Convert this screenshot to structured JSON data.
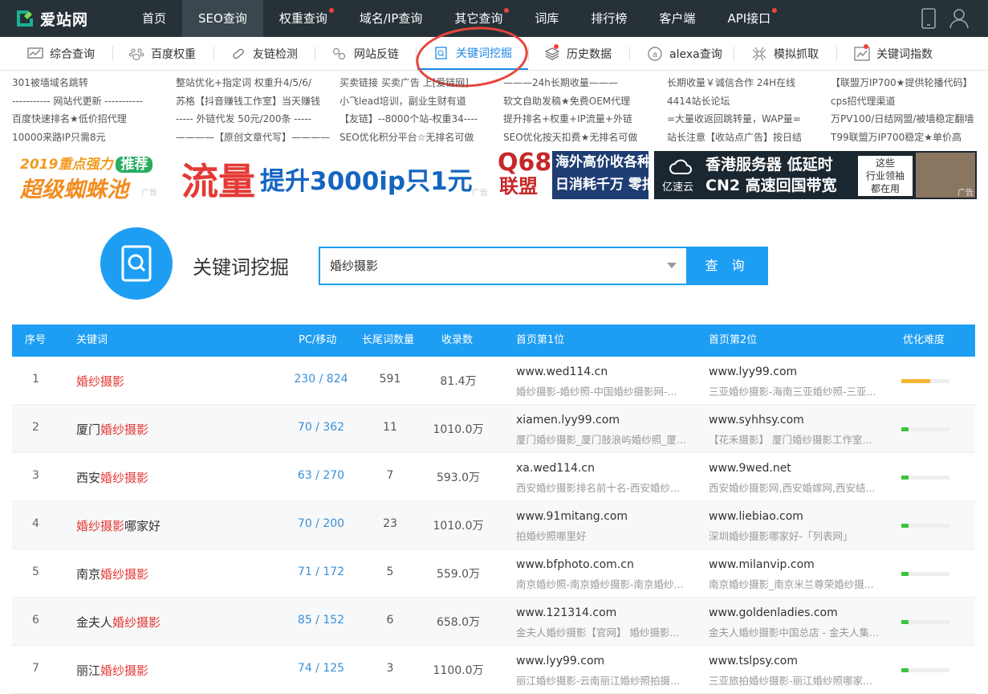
{
  "brand": {
    "name": "爱站网",
    "color": "#19b394"
  },
  "nav": {
    "items": [
      {
        "label": "首页",
        "dot": false
      },
      {
        "label": "SEO查询",
        "dot": false,
        "active": true
      },
      {
        "label": "权重查询",
        "dot": true
      },
      {
        "label": "域名/IP查询",
        "dot": false
      },
      {
        "label": "其它查询",
        "dot": true
      },
      {
        "label": "词库",
        "dot": false
      },
      {
        "label": "排行榜",
        "dot": false
      },
      {
        "label": "客户端",
        "dot": false
      },
      {
        "label": "API接口",
        "dot": true
      }
    ]
  },
  "subnav": {
    "items": [
      {
        "label": "综合查询",
        "icon": "chart-monitor-icon"
      },
      {
        "label": "百度权重",
        "icon": "baidu-paw-icon"
      },
      {
        "label": "友链检测",
        "icon": "link-icon"
      },
      {
        "label": "网站反链",
        "icon": "backlink-icon"
      },
      {
        "label": "关键词挖掘",
        "icon": "dig-icon",
        "active": true
      },
      {
        "label": "历史数据",
        "icon": "layers-icon",
        "dot": true
      },
      {
        "label": "alexa查询",
        "icon": "alexa-icon"
      },
      {
        "label": "模拟抓取",
        "icon": "spider-icon"
      },
      {
        "label": "关键词指数",
        "icon": "trend-icon",
        "dot": true
      }
    ]
  },
  "ads": {
    "text": [
      [
        "301被墙域名跳转",
        "----------- 网站代更新 -----------",
        "百度快速排名★低价招代理",
        "10000来路IP只需8元"
      ],
      [
        "整站优化+指定词 权重升4/5/6/",
        "苏格【抖音赚钱工作室】当天赚钱",
        "----- 外链代发 50元/200条 -----",
        "————【原创文章代写】————"
      ],
      [
        "买卖链接 买卖广告 上[爱链网]",
        "小飞lead培训，副业生财有道",
        "【友链】--8000个站-权重34----",
        "SEO优化积分平台☆无排名可做"
      ],
      [
        "———24h长期收量———",
        "软文自助发稿★免费OEM代理",
        "提升排名+权重+IP流量+外链",
        "SEO优化按天扣费★无排名可做"
      ],
      [
        "长期收量￥诚信合作 24H在线",
        "4414站长论坛",
        "=大量收返回跳转量，WAP量=",
        "站长注意【收站点广告】按日结"
      ],
      [
        "【联盟万IP700★提供轮播代码】",
        "cps招代理渠道",
        "万PV100/日结网盟/被墙稳定翻墙",
        "T99联盟万IP700稳定★单价高"
      ]
    ],
    "banners": [
      {
        "line1": "2019重点强力",
        "badge": "推荐",
        "line2": "超级蜘蛛池",
        "tag": "广告"
      },
      {
        "big": "流量",
        "rest": "提升3000ip只1元",
        "tag": "广告"
      },
      {
        "brand1": "Q68",
        "brand2": "联盟",
        "t1": "海外高价收各种量",
        "t2": "日消耗千万 零扣量"
      },
      {
        "logo": "亿速云",
        "t1": "香港服务器 低延时",
        "t2": "CN2 高速回国带宽",
        "side1": "这些",
        "side2": "行业领袖",
        "side3": "都在用",
        "tag": "广告"
      }
    ]
  },
  "search": {
    "title": "关键词挖掘",
    "value": "婚纱摄影",
    "button": "查 询"
  },
  "table": {
    "headers": {
      "no": "序号",
      "kw": "关键词",
      "pc": "PC/移动",
      "tail": "长尾词数量",
      "idx": "收录数",
      "first": "首页第1位",
      "second": "首页第2位",
      "diff": "优化难度"
    },
    "rows": [
      {
        "no": "1",
        "pre": "",
        "hl": "婚纱摄影",
        "post": "",
        "pc": "230 / 824",
        "tail": "591",
        "idx": "81.4万",
        "d1": "www.wed114.cn",
        "t1": "婚纱摄影-婚纱照-中国婚纱摄影网-...",
        "d2": "www.lyy99.com",
        "t2": "三亚婚纱摄影-海南三亚婚纱照-三亚...",
        "diff": 0.6,
        "color": "#f5b731"
      },
      {
        "no": "2",
        "pre": "厦门",
        "hl": "婚纱摄影",
        "post": "",
        "pc": "70 / 362",
        "tail": "11",
        "idx": "1010.0万",
        "d1": "xiamen.lyy99.com",
        "t1": "厦门婚纱摄影_厦门鼓浪屿婚纱照_厦...",
        "d2": "www.syhhsy.com",
        "t2": "【花禾摄影】 厦门婚纱摄影工作室...",
        "diff": 0.15,
        "color": "#3cc43c"
      },
      {
        "no": "3",
        "pre": "西安",
        "hl": "婚纱摄影",
        "post": "",
        "pc": "63 / 270",
        "tail": "7",
        "idx": "593.0万",
        "d1": "xa.wed114.cn",
        "t1": "西安婚纱摄影排名前十名-西安婚纱...",
        "d2": "www.9wed.net",
        "t2": "西安婚纱摄影网,西安婚嫁网,西安结...",
        "diff": 0.15,
        "color": "#3cc43c"
      },
      {
        "no": "4",
        "pre": "",
        "hl": "婚纱摄影",
        "post": "哪家好",
        "pc": "70 / 200",
        "tail": "23",
        "idx": "1010.0万",
        "d1": "www.91mitang.com",
        "t1": "拍婚纱照哪里好",
        "d2": "www.liebiao.com",
        "t2": "深圳婚纱摄影哪家好-「列表网」",
        "diff": 0.15,
        "color": "#3cc43c"
      },
      {
        "no": "5",
        "pre": "南京",
        "hl": "婚纱摄影",
        "post": "",
        "pc": "71 / 172",
        "tail": "5",
        "idx": "559.0万",
        "d1": "www.bfphoto.com.cn",
        "t1": "南京婚纱照-南京婚纱摄影-南京婚纱...",
        "d2": "www.milanvip.com",
        "t2": "南京婚纱摄影_南京米兰尊荣婚纱摄...",
        "diff": 0.15,
        "color": "#3cc43c"
      },
      {
        "no": "6",
        "pre": "金夫人",
        "hl": "婚纱摄影",
        "post": "",
        "pc": "85 / 152",
        "tail": "6",
        "idx": "658.0万",
        "d1": "www.121314.com",
        "t1": "金夫人婚纱摄影【官网】 婚纱摄影...",
        "d2": "www.goldenladies.com",
        "t2": "金夫人婚纱摄影中国总店 - 金夫人集...",
        "diff": 0.15,
        "color": "#3cc43c"
      },
      {
        "no": "7",
        "pre": "丽江",
        "hl": "婚纱摄影",
        "post": "",
        "pc": "74 / 125",
        "tail": "3",
        "idx": "1100.0万",
        "d1": "www.lyy99.com",
        "t1": "丽江婚纱摄影-云南丽江婚纱照拍摄...",
        "d2": "www.tslpsy.com",
        "t2": "三亚旅拍婚纱摄影-丽江婚纱照哪家...",
        "diff": 0.15,
        "color": "#3cc43c"
      }
    ]
  }
}
